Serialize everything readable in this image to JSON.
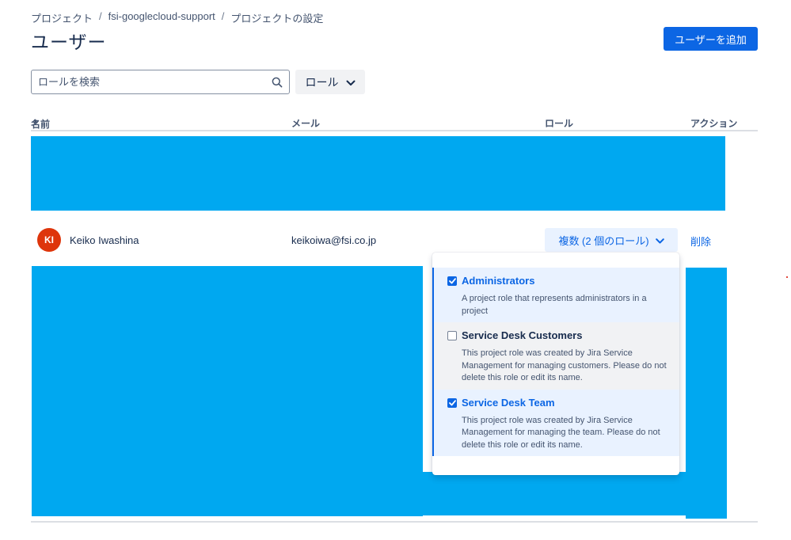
{
  "breadcrumb": {
    "items": [
      "プロジェクト",
      "fsi-googlecloud-support",
      "プロジェクトの設定"
    ],
    "separator": "/"
  },
  "page": {
    "title": "ユーザー",
    "add_user_label": "ユーザーを追加"
  },
  "search": {
    "placeholder": "ロールを検索",
    "value": ""
  },
  "role_filter": {
    "label": "ロール"
  },
  "table": {
    "columns": {
      "name": "名前",
      "email": "メール",
      "role": "ロール",
      "actions": "アクション"
    }
  },
  "user_row": {
    "avatar_initials": "KI",
    "name": "Keiko Iwashina",
    "email": "keikoiwa@fsi.co.jp",
    "role_value": "複数 (2 個のロール)",
    "delete_label": "削除"
  },
  "role_dropdown": {
    "options": [
      {
        "title": "Administrators",
        "description": "A project role that represents administrators in a project",
        "checked": true
      },
      {
        "title": "Service Desk Customers",
        "description": "This project role was created by Jira Service Management for managing customers. Please do not delete this role or edit its name.",
        "checked": false
      },
      {
        "title": "Service Desk Team",
        "description": "This project role was created by Jira Service Management for managing the team. Please do not delete this role or edit its name.",
        "checked": true
      }
    ]
  },
  "colors": {
    "primary": "#0c66e4",
    "redaction": "#00a8f0",
    "avatar": "#de350b"
  }
}
